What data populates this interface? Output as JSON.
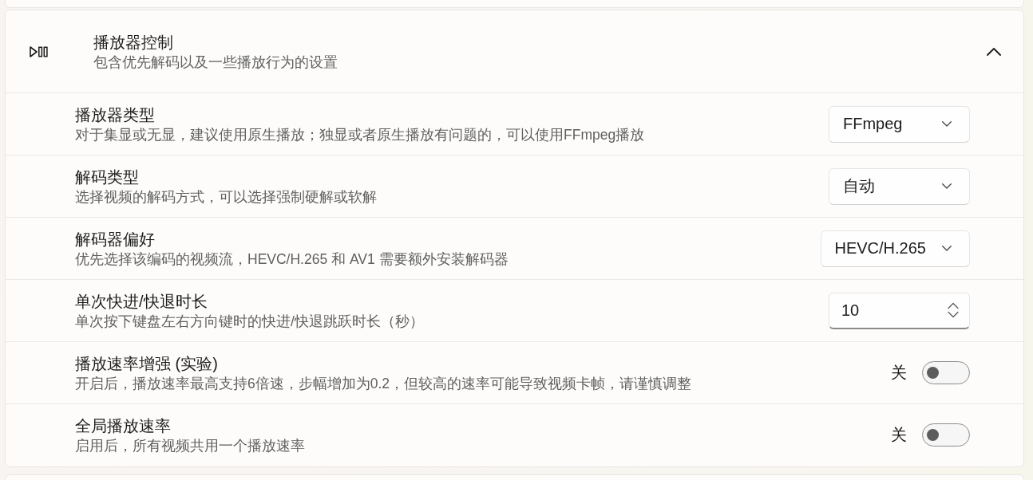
{
  "section": {
    "title": "播放器控制",
    "subtitle": "包含优先解码以及一些播放行为的设置",
    "expanded": true
  },
  "settings": [
    {
      "kind": "dropdown",
      "title": "播放器类型",
      "description": "对于集显或无显，建议使用原生播放；独显或者原生播放有问题的，可以使用FFmpeg播放",
      "value": "FFmpeg"
    },
    {
      "kind": "dropdown",
      "title": "解码类型",
      "description": "选择视频的解码方式，可以选择强制硬解或软解",
      "value": "自动"
    },
    {
      "kind": "dropdown",
      "title": "解码器偏好",
      "description": "优先选择该编码的视频流，HEVC/H.265 和 AV1 需要额外安装解码器",
      "value": "HEVC/H.265"
    },
    {
      "kind": "number",
      "title": "单次快进/快退时长",
      "description": "单次按下键盘左右方向键时的快进/快退跳跃时长（秒）",
      "value": "10"
    },
    {
      "kind": "toggle",
      "title": "播放速率增强 (实验)",
      "description": "开启后，播放速率最高支持6倍速，步幅增加为0.2，但较高的速率可能导致视频卡帧，请谨慎调整",
      "state_label": "关",
      "on": false
    },
    {
      "kind": "toggle",
      "title": "全局播放速率",
      "description": "启用后，所有视频共用一个播放速率",
      "state_label": "关",
      "on": false
    }
  ]
}
